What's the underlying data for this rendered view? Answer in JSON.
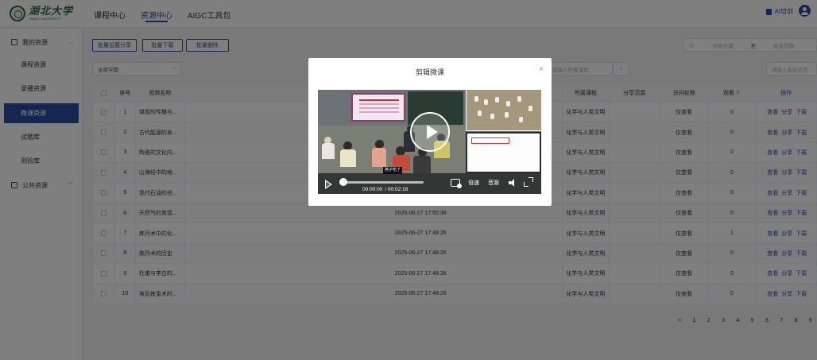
{
  "header": {
    "logo_cn": "湖北大学",
    "logo_en": "HUBEI UNIVERSITY",
    "nav": [
      {
        "label": "课程中心",
        "active": false
      },
      {
        "label": "资源中心",
        "active": true
      },
      {
        "label": "AIGC工具包",
        "active": false
      }
    ],
    "ai_training_label": "AI培训"
  },
  "sidebar": {
    "my_resources": "我的资源",
    "items": [
      {
        "label": "课程资源",
        "active": false
      },
      {
        "label": "录播资源",
        "active": false
      },
      {
        "label": "微课资源",
        "active": true
      },
      {
        "label": "试题库",
        "active": false
      },
      {
        "label": "测验库",
        "active": false
      }
    ],
    "public_resources": "公共资源"
  },
  "toolbar": {
    "batch_share": "批量设置分享",
    "batch_download": "批量下载",
    "batch_delete": "批量删除",
    "start_date_placeholder": "开始日期",
    "date_sep": "至",
    "end_date_placeholder": "结束日期",
    "semester_select": "全部学期",
    "course_search_placeholder": "请输入所属课程",
    "name_search_placeholder": "请输入视频名称"
  },
  "table": {
    "headers": {
      "index": "序号",
      "name": "视频名称",
      "course": "所属课程",
      "scope": "分享范围",
      "permission": "访问权限",
      "views": "观看",
      "ops": "操作"
    },
    "rows": [
      {
        "idx": "1",
        "name": "煤炭的传播与...",
        "time": "",
        "course": "化学与人类文明",
        "scope": "",
        "perm": "仅查看",
        "views": "0"
      },
      {
        "idx": "2",
        "name": "古代能源的发...",
        "time": "",
        "course": "化学与人类文明",
        "scope": "",
        "perm": "仅查看",
        "views": "0"
      },
      {
        "idx": "3",
        "name": "陶瓷的文化内...",
        "time": "",
        "course": "化学与人类文明",
        "scope": "",
        "perm": "仅查看",
        "views": "0"
      },
      {
        "idx": "4",
        "name": "山海经中的地...",
        "time": "",
        "course": "化学与人类文明",
        "scope": "",
        "perm": "仅查看",
        "views": "0"
      },
      {
        "idx": "5",
        "name": "现代石油的进...",
        "time": "",
        "course": "化学与人类文明",
        "scope": "",
        "perm": "仅查看",
        "views": "0"
      },
      {
        "idx": "6",
        "name": "天然气的发现...",
        "time": "2025-06-27 17:50:38",
        "course": "化学与人类文明",
        "scope": "",
        "perm": "仅查看",
        "views": "0"
      },
      {
        "idx": "7",
        "name": "炼丹术中的化...",
        "time": "2025-06-27 17:48:26",
        "course": "化学与人类文明",
        "scope": "",
        "perm": "仅查看",
        "views": "1"
      },
      {
        "idx": "8",
        "name": "炼丹术的历史",
        "time": "2025-06-27 17:48:26",
        "course": "化学与人类文明",
        "scope": "",
        "perm": "仅查看",
        "views": "0"
      },
      {
        "idx": "9",
        "name": "杜甫与李白的...",
        "time": "2025-06-27 17:48:26",
        "course": "化学与人类文明",
        "scope": "",
        "perm": "仅查看",
        "views": "0"
      },
      {
        "idx": "10",
        "name": "埃及炼金术的...",
        "time": "2025-06-27 17:48:26",
        "course": "化学与人类文明",
        "scope": "",
        "perm": "仅查看",
        "views": "0"
      }
    ],
    "op_view": "查看",
    "op_share": "分享",
    "op_download": "下载"
  },
  "pagination": {
    "prev": "<",
    "pages": [
      "1",
      "2",
      "3",
      "4",
      "5",
      "6",
      "7",
      "8",
      "9"
    ],
    "current": "1"
  },
  "modal": {
    "title": "剪辑微课",
    "close": "×",
    "video": {
      "caption": "燕子吃了",
      "current_time": "00:00:00",
      "total_time": "/ 00:02:18",
      "speed_label": "倍速",
      "quality_label": "音源",
      "progress": 0
    }
  },
  "colors": {
    "primary": "#2b4fa3",
    "logo_green": "#2e6b3c",
    "overlay": "rgba(0,0,0,0.5)"
  }
}
